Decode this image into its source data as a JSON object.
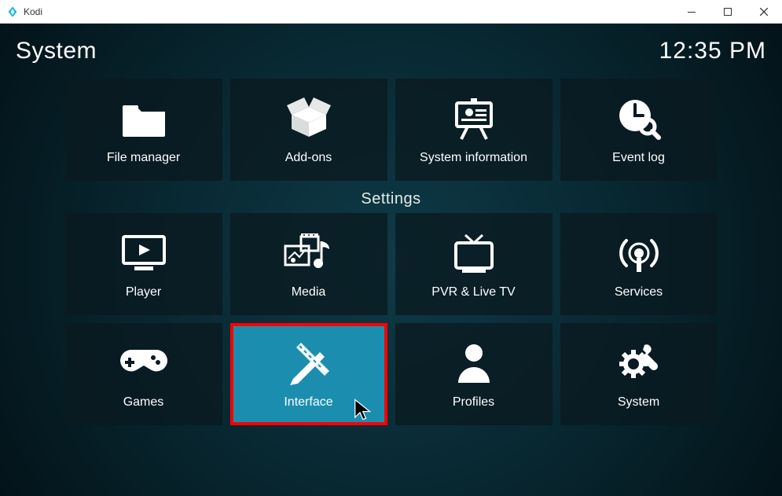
{
  "window": {
    "title": "Kodi"
  },
  "header": {
    "title": "System",
    "time": "12:35 PM"
  },
  "section_label": "Settings",
  "row1": [
    {
      "name": "file-manager",
      "label": "File manager"
    },
    {
      "name": "add-ons",
      "label": "Add-ons"
    },
    {
      "name": "system-information",
      "label": "System information"
    },
    {
      "name": "event-log",
      "label": "Event log"
    }
  ],
  "row2": [
    {
      "name": "player",
      "label": "Player"
    },
    {
      "name": "media",
      "label": "Media"
    },
    {
      "name": "pvr-live-tv",
      "label": "PVR & Live TV"
    },
    {
      "name": "services",
      "label": "Services"
    }
  ],
  "row3": [
    {
      "name": "games",
      "label": "Games"
    },
    {
      "name": "interface",
      "label": "Interface"
    },
    {
      "name": "profiles",
      "label": "Profiles"
    },
    {
      "name": "system",
      "label": "System"
    }
  ],
  "highlighted": "interface"
}
